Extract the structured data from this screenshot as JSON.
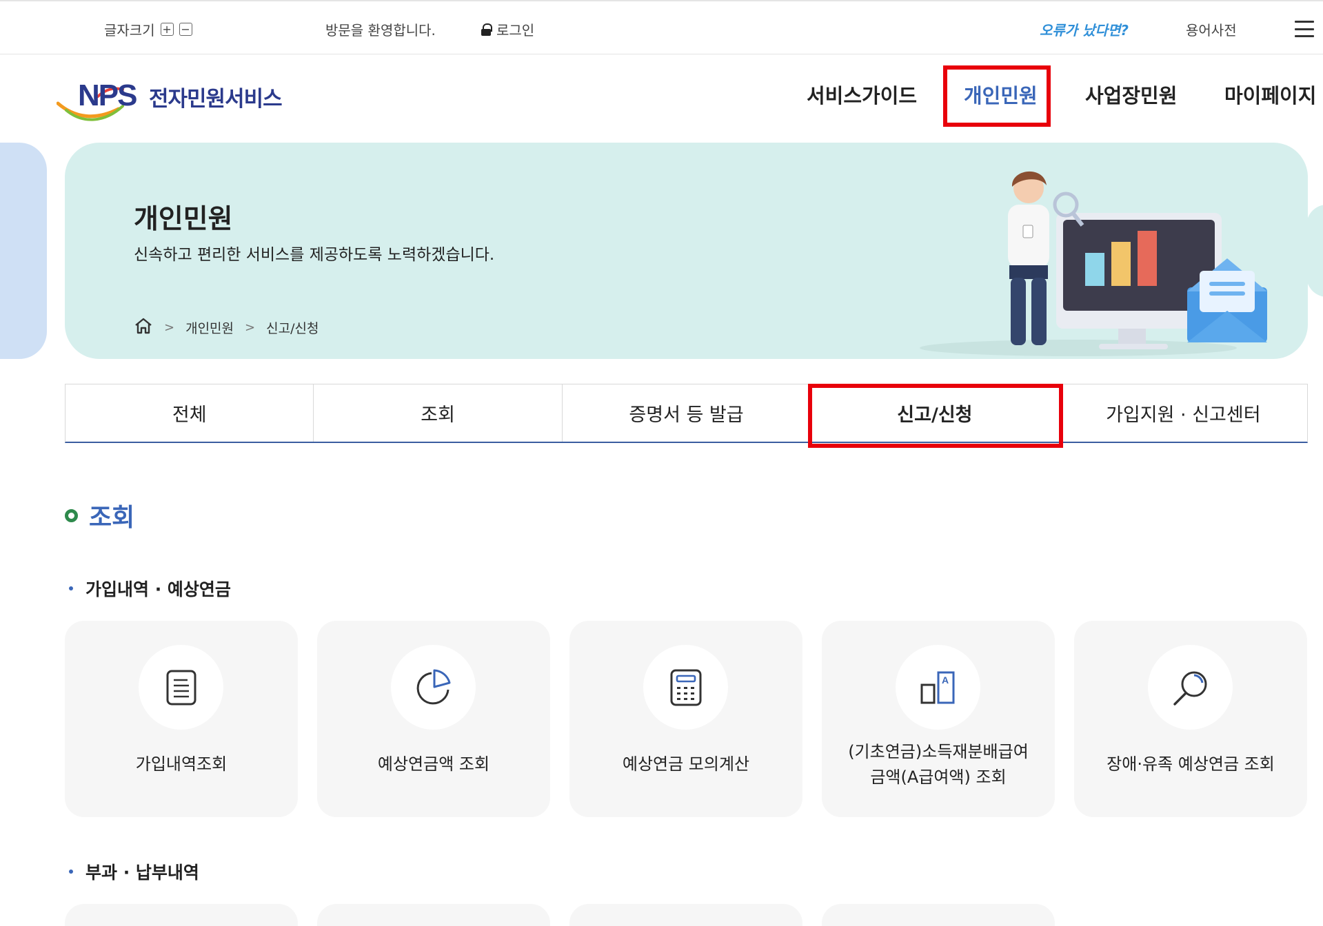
{
  "topbar": {
    "font_size_label": "글자크기",
    "font_plus": "+",
    "font_minus": "−",
    "welcome": "방문을 환영합니다.",
    "login": "로그인",
    "error_report": "오류가 났다면?",
    "glossary": "용어사전"
  },
  "header": {
    "logo_mark": "NPS",
    "logo_text": "전자민원서비스",
    "nav": [
      "서비스가이드",
      "개인민원",
      "사업장민원",
      "마이페이지"
    ],
    "active_nav": "개인민원"
  },
  "hero": {
    "title": "개인민원",
    "subtitle": "신속하고 편리한 서비스를 제공하도록 노력하겠습니다.",
    "breadcrumb": [
      "개인민원",
      "신고/신청"
    ]
  },
  "tabs": [
    "전체",
    "조회",
    "증명서 등 발급",
    "신고/신청",
    "가입지원 · 신고센터"
  ],
  "active_tab": "신고/신청",
  "section": {
    "title": "조회",
    "groups": [
      {
        "title": "가입내역 · 예상연금",
        "cards": [
          {
            "label": "가입내역조회",
            "icon": "document-icon"
          },
          {
            "label": "예상연금액 조회",
            "icon": "pie-chart-icon"
          },
          {
            "label": "예상연금 모의계산",
            "icon": "calculator-icon"
          },
          {
            "label": "(기초연금)소득재분배급여\n금액(A급여액) 조회",
            "icon": "benefit-amount-icon"
          },
          {
            "label": "장애·유족 예상연금 조회",
            "icon": "search-icon"
          }
        ]
      },
      {
        "title": "부과 · 납부내역"
      }
    ]
  },
  "colors": {
    "accent_blue": "#3a66b8",
    "hero_bg": "#d6efed",
    "highlight_red": "#e8000b",
    "error_link": "#2f8fd8"
  }
}
